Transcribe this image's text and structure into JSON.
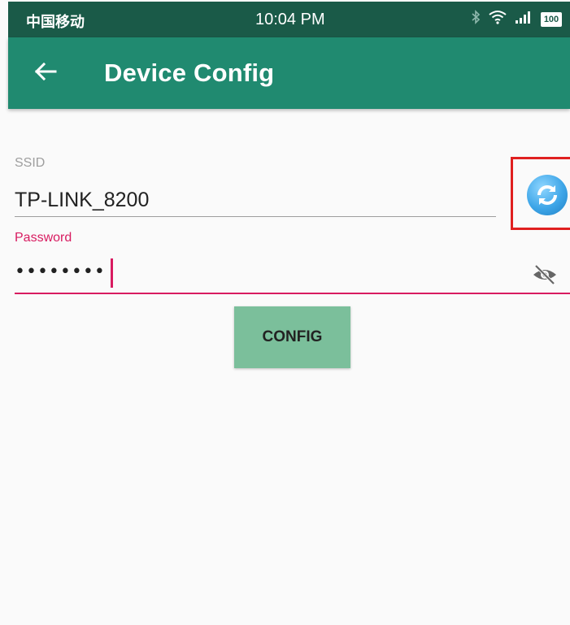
{
  "status_bar": {
    "carrier": "中国移动",
    "time": "10:04 PM",
    "icons": [
      "bluetooth-icon",
      "wifi-icon",
      "signal-icon",
      "battery-icon"
    ],
    "battery": "100"
  },
  "app_bar": {
    "title": "Device Config",
    "back_icon": "arrow-left-icon",
    "color": "#208a70"
  },
  "form": {
    "ssid": {
      "label": "SSID",
      "value": "TP-LINK_8200"
    },
    "refresh_icon": "refresh-icon",
    "password": {
      "label": "Password",
      "masked_value": "••••••••"
    },
    "visibility_icon": "eye-off-icon",
    "accent_color": "#d81b60",
    "config_button": "CONFIG"
  },
  "highlight_color": "#e02020"
}
